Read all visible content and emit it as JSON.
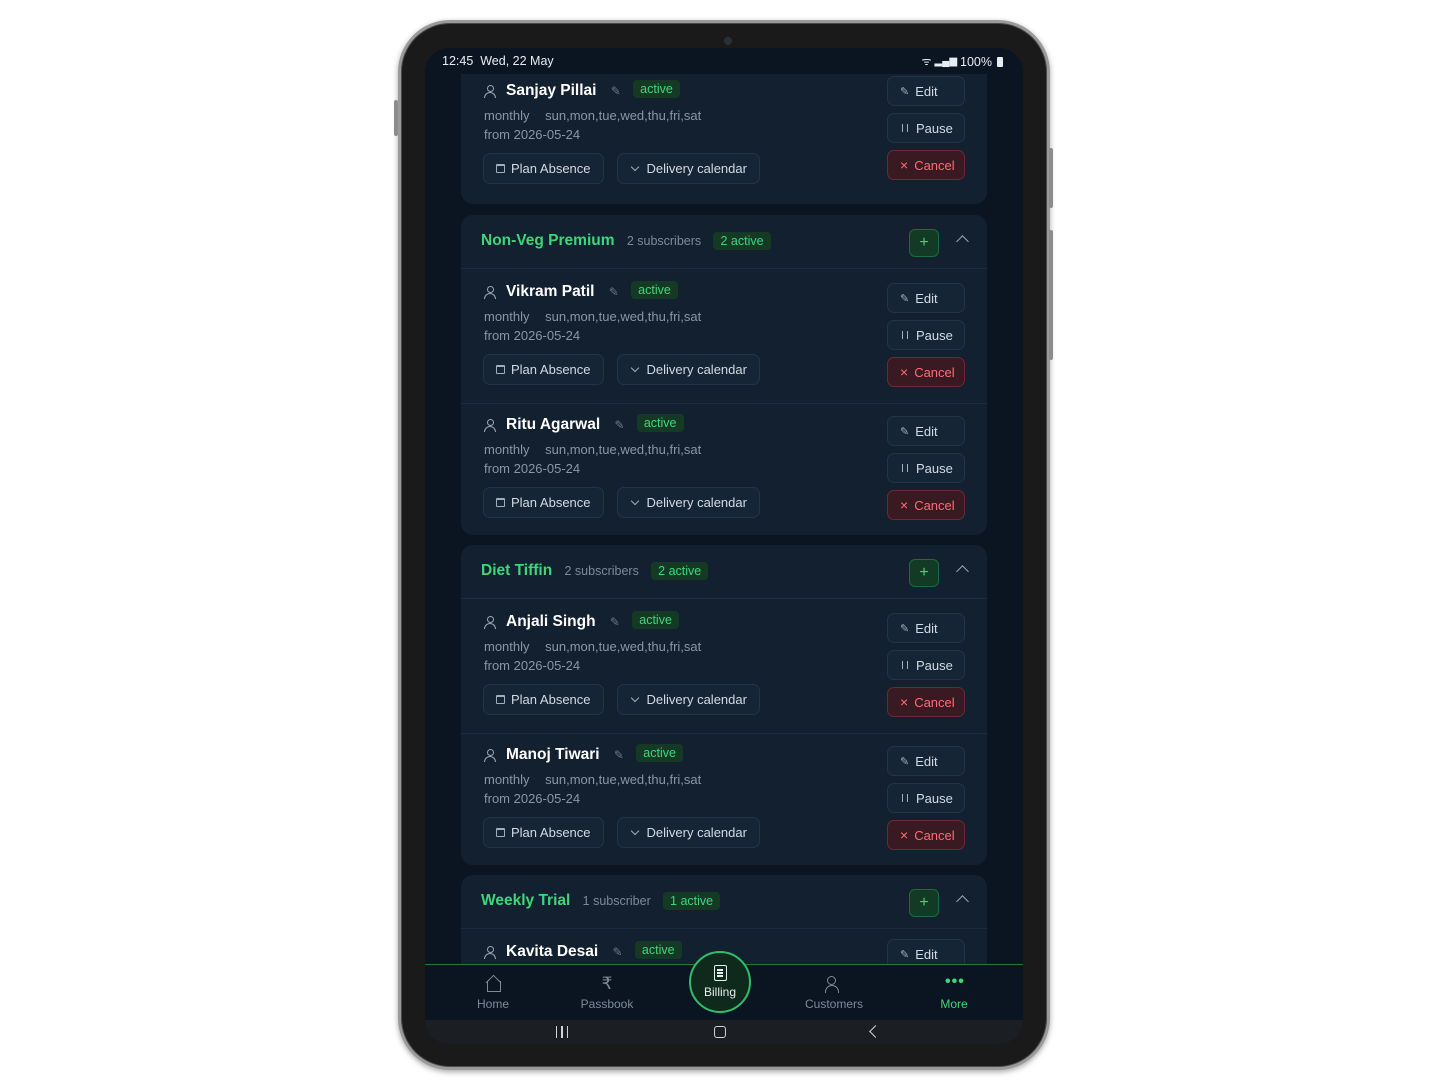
{
  "status_bar": {
    "time": "12:45",
    "date": "Wed, 22 May",
    "battery": "100%"
  },
  "labels": {
    "plan_absence": "Plan Absence",
    "delivery_calendar": "Delivery calendar",
    "edit": "Edit",
    "pause": "Pause",
    "cancel": "Cancel",
    "active": "active",
    "add": "+"
  },
  "top_card": {
    "name": "Sanjay Pillai",
    "status": "active",
    "frequency": "monthly",
    "days": "sun,mon,tue,wed,thu,fri,sat",
    "from": "from 2026-05-24"
  },
  "groups": [
    {
      "title": "Non-Veg Premium",
      "subscribers": "2 subscribers",
      "active_count": "2 active",
      "subs": [
        {
          "name": "Vikram Patil",
          "status": "active",
          "frequency": "monthly",
          "days": "sun,mon,tue,wed,thu,fri,sat",
          "from": "from 2026-05-24"
        },
        {
          "name": "Ritu Agarwal",
          "status": "active",
          "frequency": "monthly",
          "days": "sun,mon,tue,wed,thu,fri,sat",
          "from": "from 2026-05-24"
        }
      ]
    },
    {
      "title": "Diet Tiffin",
      "subscribers": "2 subscribers",
      "active_count": "2 active",
      "subs": [
        {
          "name": "Anjali Singh",
          "status": "active",
          "frequency": "monthly",
          "days": "sun,mon,tue,wed,thu,fri,sat",
          "from": "from 2026-05-24"
        },
        {
          "name": "Manoj Tiwari",
          "status": "active",
          "frequency": "monthly",
          "days": "sun,mon,tue,wed,thu,fri,sat",
          "from": "from 2026-05-24"
        }
      ]
    },
    {
      "title": "Weekly Trial",
      "subscribers": "1 subscriber",
      "active_count": "1 active",
      "subs": [
        {
          "name": "Kavita Desai",
          "status": "active"
        }
      ]
    }
  ],
  "bottom_nav": {
    "home": "Home",
    "passbook": "Passbook",
    "billing": "Billing",
    "customers": "Customers",
    "more": "More",
    "active_item": "More"
  },
  "icons": {
    "person": "person-icon",
    "pencil": "pencil-icon",
    "calendar": "calendar-icon",
    "chevron": "chevron-down-icon",
    "pause": "pause-icon",
    "close": "close-icon",
    "home": "home-icon",
    "rupee": "rupee-icon",
    "receipt": "receipt-icon",
    "people": "people-icon",
    "more": "more-icon"
  },
  "colors": {
    "accent": "#3fd67a",
    "danger": "#ff6b74",
    "background": "#0b1521",
    "card": "#122030"
  }
}
